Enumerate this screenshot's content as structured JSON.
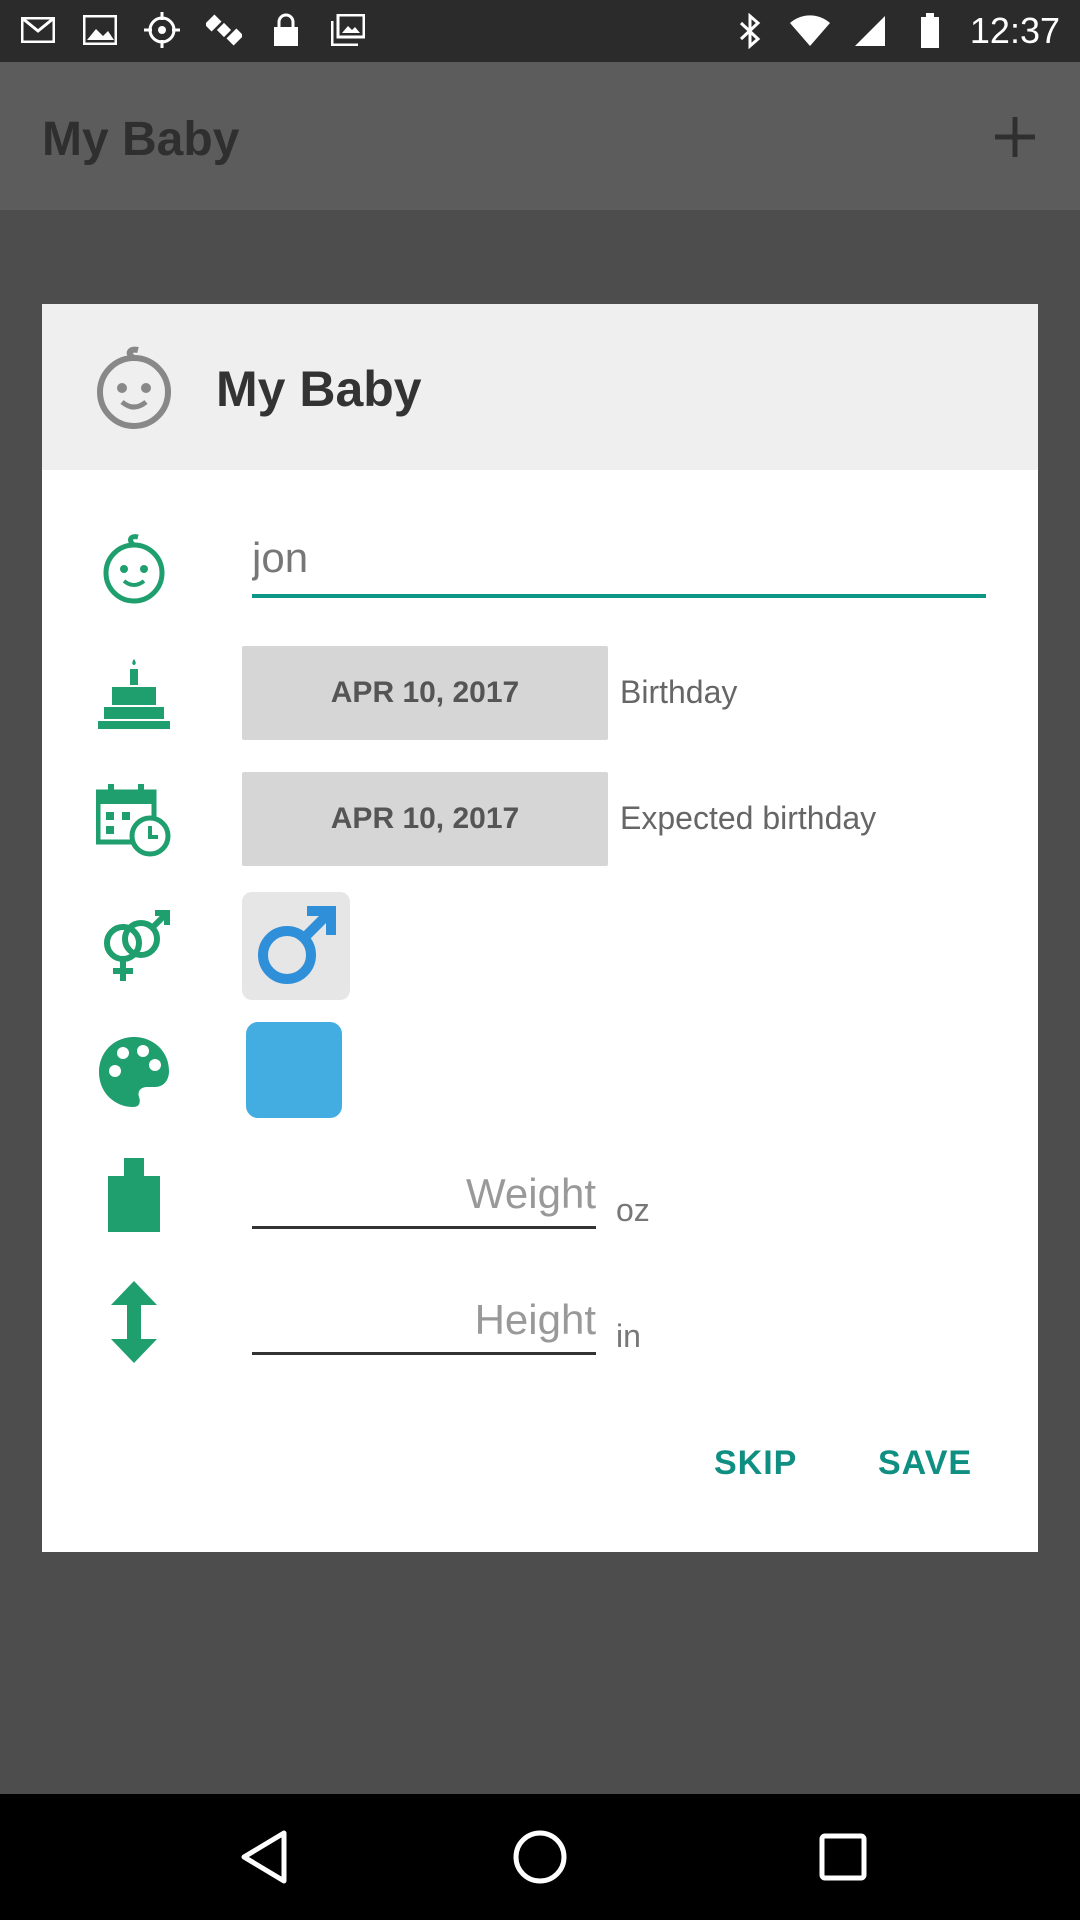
{
  "status_bar": {
    "time": "12:37",
    "icons": [
      "mail-icon",
      "image-icon",
      "fake-gps-icon",
      "satellite-icon",
      "lock-icon",
      "gallery-icon",
      "bluetooth-icon",
      "wifi-icon",
      "signal-icon",
      "battery-icon"
    ]
  },
  "app_bar": {
    "title": "My Baby",
    "add_icon": "plus-icon"
  },
  "dialog": {
    "title": "My Baby",
    "name_value": "jon",
    "birthday": {
      "date": "APR 10, 2017",
      "label": "Birthday"
    },
    "expected_birthday": {
      "date": "APR 10, 2017",
      "label": "Expected birthday"
    },
    "gender": "male",
    "color": "#43ace0",
    "weight": {
      "placeholder": "Weight",
      "unit": "oz"
    },
    "height": {
      "placeholder": "Height",
      "unit": "in"
    },
    "skip_label": "SKIP",
    "save_label": "SAVE"
  },
  "colors": {
    "accent": "#0e9686",
    "icon_green": "#1f9e6e",
    "male_blue": "#2f8fd8"
  }
}
